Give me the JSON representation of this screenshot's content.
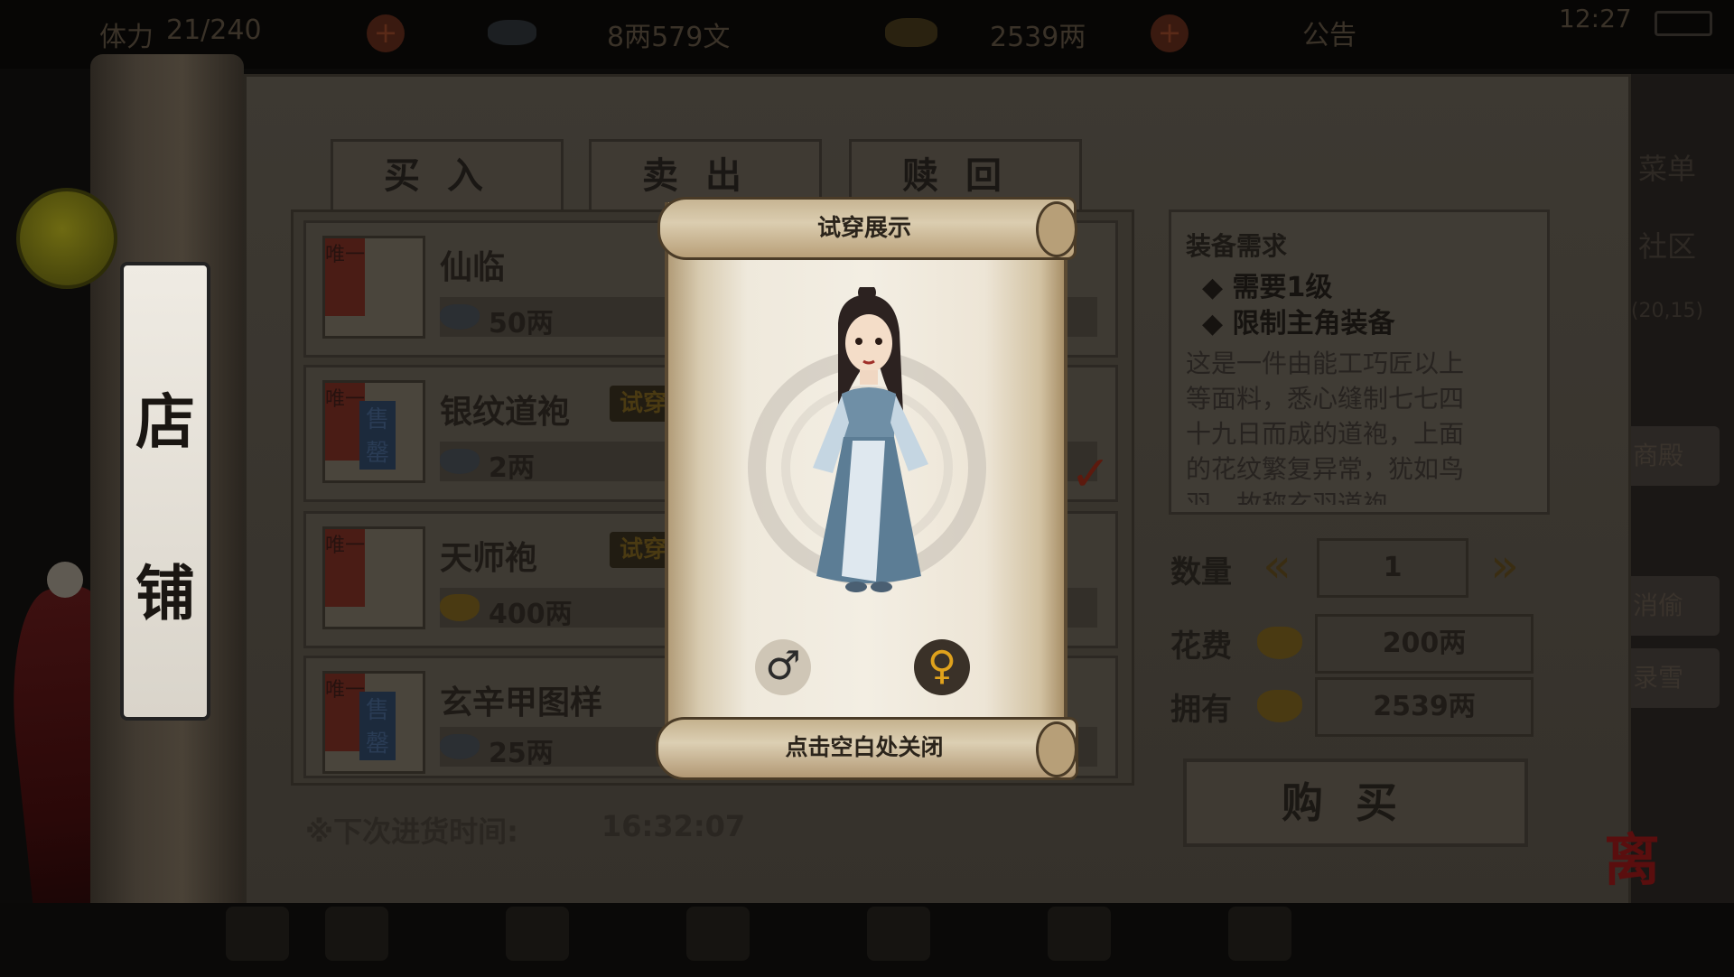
{
  "topbar": {
    "stamina_label": "体力",
    "stamina": "21/240",
    "silver": "8两579文",
    "gold": "2539两",
    "notice": "公告",
    "time": "12:27"
  },
  "shop_title": [
    "店",
    "铺"
  ],
  "tabs": [
    "买入",
    "卖出",
    "赎回"
  ],
  "side_menu": [
    "菜单",
    "社区",
    "(20,15)",
    "商殿",
    "消偷",
    "录雪"
  ],
  "items": [
    {
      "name": "仙临",
      "price": "50两",
      "currency": "silver",
      "badge": "唯一",
      "tryon": false,
      "sold": false
    },
    {
      "name": "银纹道袍",
      "price": "2两",
      "currency": "silver",
      "badge": "唯一",
      "tryon": true,
      "tryon_label": "试穿",
      "sold": true,
      "sold_label": "售罄"
    },
    {
      "name": "天师袍",
      "price": "400两",
      "currency": "gold",
      "badge": "唯一",
      "tryon": true,
      "tryon_label": "试穿",
      "sold": false
    },
    {
      "name": "玄辛甲图样",
      "price": "25两",
      "currency": "silver",
      "badge": "唯一",
      "tryon": false,
      "sold": true,
      "sold_label": "售罄"
    }
  ],
  "restock": {
    "label": "※下次进货时间:",
    "time": "16:32:07"
  },
  "requirements": {
    "title": "装备需求",
    "lines": [
      "◆ 需要1级",
      "◆ 限制主角装备"
    ],
    "description": [
      "这是一件由能工巧匠以上",
      "等面料，悉心缝制七七四",
      "十九日而成的道袍，上面",
      "的花纹繁复异常，犹如鸟",
      "羽，故称玄羽道袍。"
    ]
  },
  "quantity": {
    "label": "数量",
    "value": "1"
  },
  "cost": {
    "label": "花费",
    "value": "200两"
  },
  "owned": {
    "label": "拥有",
    "value": "2539两"
  },
  "buy_label": "购买",
  "leave_label": "离开",
  "popup": {
    "title": "试穿展示",
    "hint": "点击空白处关闭",
    "male_symbol": "♂",
    "female_symbol": "♀"
  },
  "colors": {
    "gold_accent": "#e0a21c",
    "scroll_paper": "#f1ebdf",
    "red_check": "#8a1e10"
  }
}
